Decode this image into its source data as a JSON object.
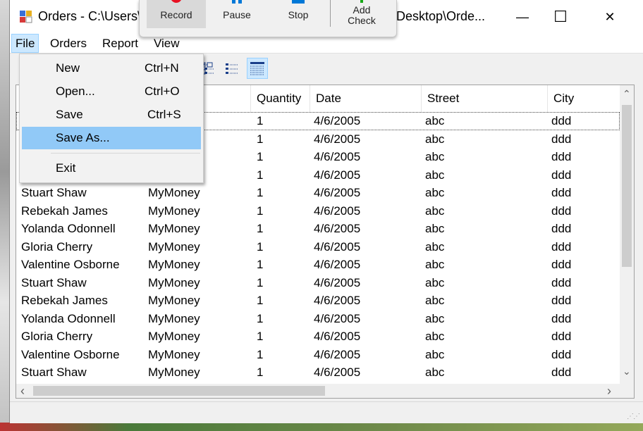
{
  "window": {
    "title_left": "Orders - C:\\Users\\",
    "title_right": "Desktop\\Orde..."
  },
  "window_controls": {
    "minimize": "—",
    "maximize": "☐",
    "close": "✕"
  },
  "recorder_toolbar": {
    "buttons": [
      {
        "label": "Record",
        "icon": "record-icon",
        "color": "#e81123"
      },
      {
        "label": "Pause",
        "icon": "pause-icon",
        "color": "#0078d7"
      },
      {
        "label": "Stop",
        "icon": "stop-icon",
        "color": "#0078d7"
      },
      {
        "label_line1": "Add",
        "label_line2": "Check",
        "icon": "add-check-icon",
        "color": "#16a816"
      }
    ]
  },
  "menubar": {
    "items": [
      "File",
      "Orders",
      "Report",
      "View"
    ]
  },
  "file_menu": {
    "items": [
      {
        "label": "New",
        "shortcut": "Ctrl+N"
      },
      {
        "label": "Open...",
        "shortcut": "Ctrl+O"
      },
      {
        "label": "Save",
        "shortcut": "Ctrl+S"
      },
      {
        "label": "Save As...",
        "shortcut": ""
      },
      {
        "label": "Exit",
        "shortcut": ""
      }
    ],
    "highlighted": "Save As..."
  },
  "toolbar": {
    "view_buttons": [
      "large-icons-view-icon",
      "small-icons-view-icon",
      "list-view-icon",
      "details-view-icon"
    ],
    "active": "details-view-icon"
  },
  "grid": {
    "columns": [
      "Quantity",
      "Date",
      "Street",
      "City"
    ],
    "rows": [
      {
        "name": "",
        "product": "",
        "quantity": "1",
        "date": "4/6/2005",
        "street": "abc",
        "city": "ddd"
      },
      {
        "name": "",
        "product": "",
        "quantity": "1",
        "date": "4/6/2005",
        "street": "abc",
        "city": "ddd"
      },
      {
        "name": "",
        "product": "",
        "quantity": "1",
        "date": "4/6/2005",
        "street": "abc",
        "city": "ddd"
      },
      {
        "name": "",
        "product": "",
        "quantity": "1",
        "date": "4/6/2005",
        "street": "abc",
        "city": "ddd"
      },
      {
        "name": "Stuart Shaw",
        "product": "MyMoney",
        "quantity": "1",
        "date": "4/6/2005",
        "street": "abc",
        "city": "ddd"
      },
      {
        "name": "Rebekah James",
        "product": "MyMoney",
        "quantity": "1",
        "date": "4/6/2005",
        "street": "abc",
        "city": "ddd"
      },
      {
        "name": "Yolanda Odonnell",
        "product": "MyMoney",
        "quantity": "1",
        "date": "4/6/2005",
        "street": "abc",
        "city": "ddd"
      },
      {
        "name": "Gloria Cherry",
        "product": "MyMoney",
        "quantity": "1",
        "date": "4/6/2005",
        "street": "abc",
        "city": "ddd"
      },
      {
        "name": "Valentine Osborne",
        "product": "MyMoney",
        "quantity": "1",
        "date": "4/6/2005",
        "street": "abc",
        "city": "ddd"
      },
      {
        "name": "Stuart Shaw",
        "product": "MyMoney",
        "quantity": "1",
        "date": "4/6/2005",
        "street": "abc",
        "city": "ddd"
      },
      {
        "name": "Rebekah James",
        "product": "MyMoney",
        "quantity": "1",
        "date": "4/6/2005",
        "street": "abc",
        "city": "ddd"
      },
      {
        "name": "Yolanda Odonnell",
        "product": "MyMoney",
        "quantity": "1",
        "date": "4/6/2005",
        "street": "abc",
        "city": "ddd"
      },
      {
        "name": "Gloria Cherry",
        "product": "MyMoney",
        "quantity": "1",
        "date": "4/6/2005",
        "street": "abc",
        "city": "ddd"
      },
      {
        "name": "Valentine Osborne",
        "product": "MyMoney",
        "quantity": "1",
        "date": "4/6/2005",
        "street": "abc",
        "city": "ddd"
      },
      {
        "name": "Stuart Shaw",
        "product": "MyMoney",
        "quantity": "1",
        "date": "4/6/2005",
        "street": "abc",
        "city": "ddd"
      }
    ]
  },
  "scrollbars": {
    "up": "⌃",
    "down": "⌄",
    "left": "‹",
    "right": "›"
  }
}
